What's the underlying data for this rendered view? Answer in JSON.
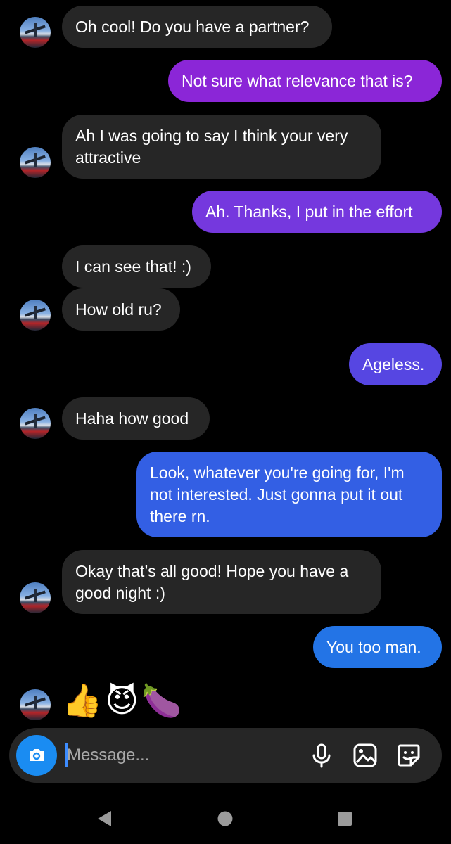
{
  "messages": [
    {
      "id": "m1",
      "sender": "them",
      "text": "Oh cool! Do you have a partner?"
    },
    {
      "id": "m2",
      "sender": "me",
      "text": "Not sure what relevance that is?"
    },
    {
      "id": "m3",
      "sender": "them",
      "text": "Ah I was going to say I think your very attractive"
    },
    {
      "id": "m4",
      "sender": "me",
      "text": "Ah. Thanks, I put in the effort"
    },
    {
      "id": "m5",
      "sender": "them",
      "text": "I can see that! :)"
    },
    {
      "id": "m6",
      "sender": "them",
      "text": "How old ru?"
    },
    {
      "id": "m7",
      "sender": "me",
      "text": "Ageless."
    },
    {
      "id": "m8",
      "sender": "them",
      "text": "Haha how good"
    },
    {
      "id": "m9",
      "sender": "me",
      "text": "Look, whatever you're going for, I'm not interested. Just gonna put it out there rn."
    },
    {
      "id": "m10",
      "sender": "them",
      "text": "Okay that’s all good! Hope you have a good night :)"
    },
    {
      "id": "m11",
      "sender": "me",
      "text": "You too man."
    }
  ],
  "emoji_reply": {
    "thumbs": "👍",
    "devil": "😈",
    "eggplant": "🍆"
  },
  "composer": {
    "placeholder": "Message...",
    "value": ""
  },
  "icons": {
    "camera": "camera-icon",
    "microphone": "microphone-icon",
    "gallery": "gallery-icon",
    "sticker": "sticker-icon",
    "back": "back-icon",
    "home": "home-icon",
    "recents": "recents-icon"
  },
  "colors": {
    "background": "#000000",
    "incoming_bubble": "#262626",
    "outgoing_purple": "#8a2be2",
    "outgoing_blue": "#2f6ee8",
    "camera_button": "#1a8cf2"
  }
}
